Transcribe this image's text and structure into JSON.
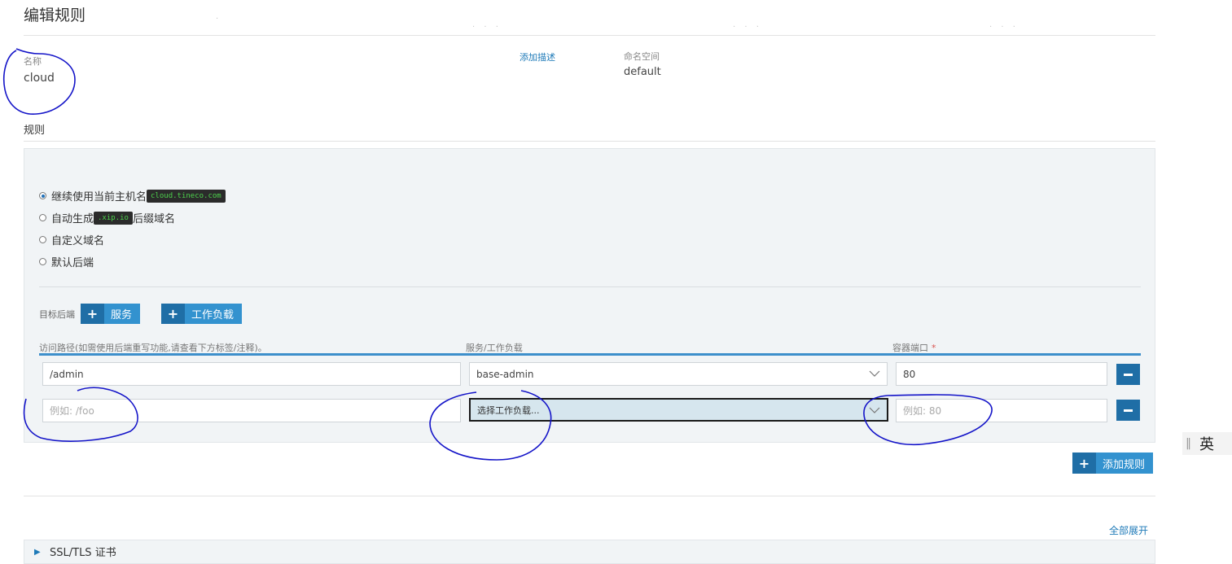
{
  "page": {
    "title": "编辑规则"
  },
  "name_field": {
    "label": "名称",
    "value": "cloud"
  },
  "add_description_link": "添加描述",
  "namespace_field": {
    "label": "命名空间",
    "value": "default"
  },
  "rules_section": {
    "title": "规则"
  },
  "host_options": [
    {
      "label": "继续使用当前主机名",
      "chip": "cloud.tineco.com",
      "suffix": "",
      "checked": true
    },
    {
      "label": "自动生成",
      "chip": ".xip.io",
      "suffix": "后缀域名",
      "checked": false
    },
    {
      "label": "自定义域名",
      "chip": "",
      "suffix": "",
      "checked": false
    },
    {
      "label": "默认后端",
      "chip": "",
      "suffix": "",
      "checked": false
    }
  ],
  "target_backend": {
    "label": "目标后端",
    "service_button": "服务",
    "workload_button": "工作负载"
  },
  "columns": {
    "path": "访问路径(如需使用后端重写功能,请查看下方标签/注释)。",
    "service": "服务/工作负载",
    "port": "容器端口",
    "port_required_mark": "*"
  },
  "rows": [
    {
      "path_value": "/admin",
      "path_placeholder": "",
      "service_value": "base-admin",
      "port_value": "80",
      "port_placeholder": ""
    },
    {
      "path_value": "",
      "path_placeholder": "例如: /foo",
      "service_value": "选择工作负载...",
      "port_value": "",
      "port_placeholder": "例如: 80"
    }
  ],
  "add_rule_button": "添加规则",
  "expand_all_link": "全部展开",
  "ssl_section": {
    "title": "SSL/TLS 证书"
  },
  "ime_indicator": {
    "label": "英"
  },
  "colors": {
    "accent": "#3392cf",
    "accent_dark": "#1f6ea6",
    "annotation": "#1414c8"
  }
}
